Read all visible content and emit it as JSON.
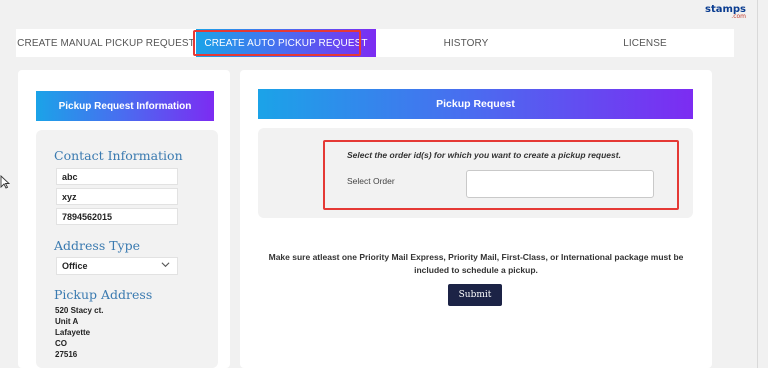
{
  "brand": {
    "name": "stamps",
    "suffix": ".com"
  },
  "tabs": [
    {
      "label": "CREATE MANUAL PICKUP REQUEST",
      "active": false
    },
    {
      "label": "CREATE AUTO PICKUP REQUEST",
      "active": true
    },
    {
      "label": "HISTORY",
      "active": false
    },
    {
      "label": "LICENSE",
      "active": false
    }
  ],
  "left": {
    "header": "Pickup Request Information",
    "contact_title": "Contact Information",
    "contact_fields": [
      "abc",
      "xyz",
      "7894562015"
    ],
    "address_type_title": "Address Type",
    "address_type_value": "Office",
    "pickup_address_title": "Pickup Address",
    "pickup_address_lines": [
      "520 Stacy ct.",
      "Unit A",
      "Lafayette",
      "CO",
      "27516"
    ]
  },
  "right": {
    "header": "Pickup Request",
    "order_instruction": "Select the order id(s) for which you want to create a pickup request.",
    "select_order_label": "Select Order",
    "select_order_value": "",
    "notice": "Make sure atleast one Priority Mail Express, Priority Mail, First-Class, or International package must be included to schedule a pickup.",
    "submit_label": "Submit"
  },
  "colors": {
    "gradient_start": "#1ba3e8",
    "gradient_end": "#7c2cf2",
    "highlight": "#e53935",
    "submit_bg": "#1c2346",
    "section_title": "#3a7ab0"
  }
}
